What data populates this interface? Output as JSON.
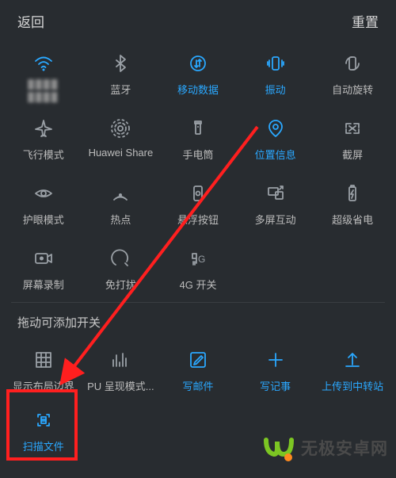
{
  "header": {
    "back": "返回",
    "reset": "重置"
  },
  "wifi_ssid": "████",
  "section_title": "拖动可添加开关",
  "rows": [
    [
      {
        "name": "wifi",
        "label": "",
        "active": true,
        "icon": "wifi"
      },
      {
        "name": "bluetooth",
        "label": "蓝牙",
        "active": false,
        "icon": "bluetooth"
      },
      {
        "name": "mobile-data",
        "label": "移动数据",
        "active": true,
        "icon": "mobile-data"
      },
      {
        "name": "vibrate",
        "label": "振动",
        "active": true,
        "icon": "vibrate"
      },
      {
        "name": "auto-rotate",
        "label": "自动旋转",
        "active": false,
        "icon": "rotate"
      }
    ],
    [
      {
        "name": "airplane",
        "label": "飞行模式",
        "active": false,
        "icon": "airplane"
      },
      {
        "name": "huawei-share",
        "label": "Huawei Share",
        "active": false,
        "icon": "share"
      },
      {
        "name": "flashlight",
        "label": "手电筒",
        "active": false,
        "icon": "flashlight"
      },
      {
        "name": "location",
        "label": "位置信息",
        "active": true,
        "icon": "location"
      },
      {
        "name": "screenshot",
        "label": "截屏",
        "active": false,
        "icon": "screenshot"
      }
    ],
    [
      {
        "name": "eye-comfort",
        "label": "护眼模式",
        "active": false,
        "icon": "eye"
      },
      {
        "name": "hotspot",
        "label": "热点",
        "active": false,
        "icon": "hotspot"
      },
      {
        "name": "float-button",
        "label": "悬浮按钮",
        "active": false,
        "icon": "float"
      },
      {
        "name": "multi-screen",
        "label": "多屏互动",
        "active": false,
        "icon": "multiscreen"
      },
      {
        "name": "super-save",
        "label": "超级省电",
        "active": false,
        "icon": "battery"
      }
    ],
    [
      {
        "name": "screen-record",
        "label": "屏幕录制",
        "active": false,
        "icon": "record"
      },
      {
        "name": "dnd",
        "label": "免打扰",
        "active": false,
        "icon": "dnd"
      },
      {
        "name": "4g-switch",
        "label": "4G 开关",
        "active": false,
        "icon": "4g"
      },
      {
        "name": "empty1",
        "label": "",
        "active": false,
        "icon": ""
      },
      {
        "name": "empty2",
        "label": "",
        "active": false,
        "icon": ""
      }
    ]
  ],
  "extra": [
    {
      "name": "layout-bounds",
      "label": "显示布局边界",
      "active": false,
      "icon": "bounds"
    },
    {
      "name": "gpu-render",
      "label": "PU 呈现模式...",
      "active": false,
      "icon": "gpu"
    },
    {
      "name": "compose-mail",
      "label": "写邮件",
      "active": true,
      "icon": "compose"
    },
    {
      "name": "write-note",
      "label": "写记事",
      "active": true,
      "icon": "plus"
    },
    {
      "name": "upload-transit",
      "label": "上传到中转站",
      "active": true,
      "icon": "upload"
    }
  ],
  "extra2": [
    {
      "name": "scan-file",
      "label": "扫描文件",
      "active": true,
      "icon": "scan"
    }
  ],
  "watermark": "无极安卓网"
}
